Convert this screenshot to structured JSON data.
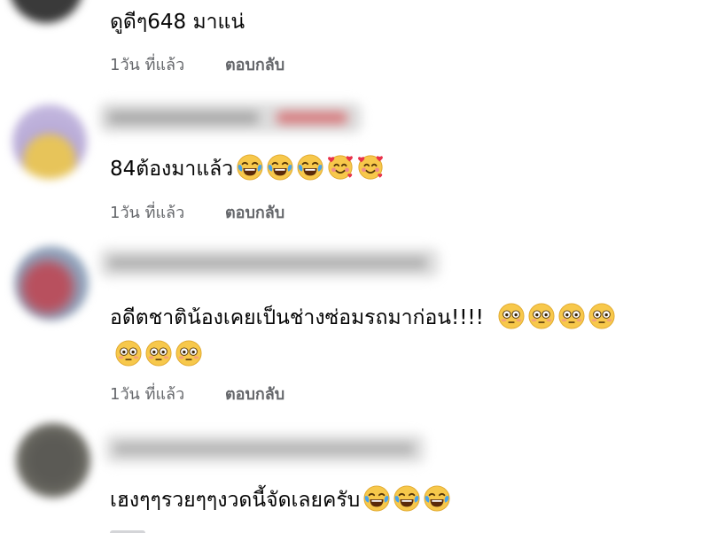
{
  "comments": [
    {
      "text": "ดูดีๆ648 มาแน่",
      "emojis": [],
      "time": "1วัน ที่แล้ว",
      "reply": "ตอบกลับ"
    },
    {
      "text": "84ต้องมาแล้ว",
      "emojis": [
        "tears-of-joy",
        "tears-of-joy",
        "tears-of-joy",
        "smiling-face-with-hearts",
        "smiling-face-with-hearts"
      ],
      "time": "1วัน ที่แล้ว",
      "reply": "ตอบกลับ"
    },
    {
      "text": "อดีตชาติน้องเคยเป็นช่างซ่อมรถมาก่อน!!!!",
      "emojis": [
        "flushed",
        "flushed",
        "flushed",
        "flushed"
      ],
      "emojis_line2": [
        "flushed",
        "flushed",
        "flushed"
      ],
      "time": "1วัน ที่แล้ว",
      "reply": "ตอบกลับ"
    },
    {
      "text": "เฮงๆๆรวยๆๆงวดนี้จัดเลยครับ",
      "emojis": [
        "tears-of-joy",
        "tears-of-joy",
        "tears-of-joy"
      ]
    }
  ]
}
